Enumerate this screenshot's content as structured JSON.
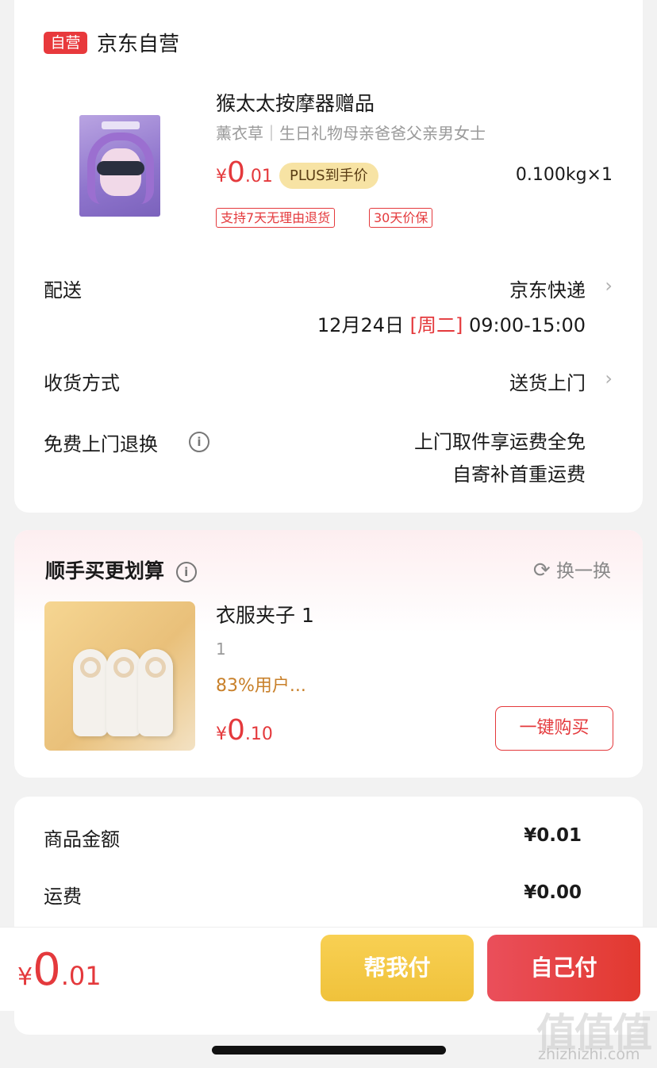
{
  "shop": {
    "badge": "自营",
    "name": "京东自营"
  },
  "product": {
    "title": "猴太太按摩器赠品",
    "spec": "薰衣草｜生日礼物母亲爸爸父亲男女士",
    "price_symbol": "¥",
    "price_int": "0",
    "price_dec": ".01",
    "plus_tag": "PLUS到手价",
    "weight_qty": "0.100kg×1",
    "service_tags": [
      "支持7天无理由退货",
      "30天价保"
    ]
  },
  "delivery": {
    "label": "配送",
    "carrier": "京东快递",
    "date": "12月24日",
    "weekday": "[周二]",
    "time": "09:00-15:00"
  },
  "receive": {
    "label": "收货方式",
    "value": "送货上门"
  },
  "free_return": {
    "label": "免费上门退换",
    "info_icon": "i",
    "line1": "上门取件享运费全免",
    "line2": "自寄补首重运费"
  },
  "addon": {
    "title": "顺手买更划算",
    "refresh_label": "换一换",
    "item": {
      "name": "衣服夹子 1",
      "spec": "1",
      "rating": "83%用户...",
      "price_symbol": "¥",
      "price_int": "0",
      "price_dec": ".10",
      "buy_label": "一键购买"
    }
  },
  "summary": [
    {
      "label": "商品金额",
      "value": "¥0.01"
    },
    {
      "label": "运费",
      "value": "¥0.00"
    }
  ],
  "footer": {
    "total_symbol": "¥",
    "total_int": "0",
    "total_dec": ".01",
    "help_pay_label": "帮我付",
    "self_pay_label": "自己付"
  },
  "watermark": {
    "logo": "值值值",
    "url": "zhizhizhi.com"
  },
  "colors": {
    "accent": "#e4393c",
    "plus_gold": "#f7e3a4",
    "help_btn": "#f0c23b",
    "self_btn": "#e2392f"
  }
}
